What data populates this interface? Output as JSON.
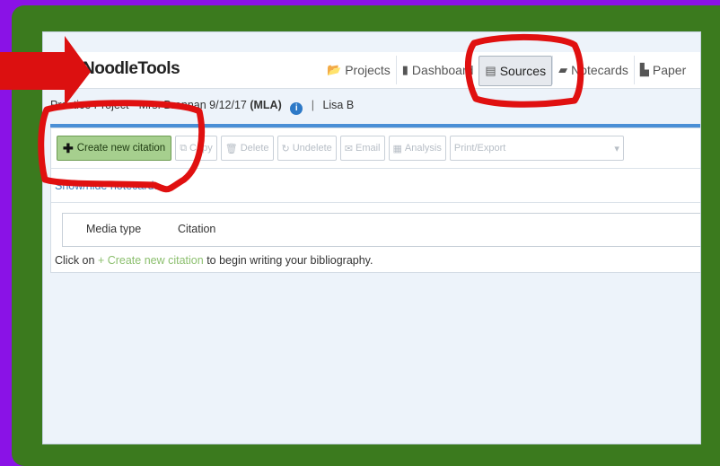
{
  "app": {
    "logo": "NoodleTools"
  },
  "nav": [
    {
      "label": "Projects",
      "icon": "folder-icon",
      "glyph": "📂",
      "active": false
    },
    {
      "label": "Dashboard",
      "icon": "bar-chart-icon",
      "glyph": "▮",
      "active": false
    },
    {
      "label": "Sources",
      "icon": "list-icon",
      "glyph": "▤",
      "active": true
    },
    {
      "label": "Notecards",
      "icon": "notecards-icon",
      "glyph": "▰",
      "active": false
    },
    {
      "label": "Paper",
      "icon": "document-icon",
      "glyph": "▙",
      "active": false
    }
  ],
  "project": {
    "title": "Practice Project - Mrs. Brennan 9/12/17",
    "style": "(MLA)",
    "info_glyph": "i",
    "separator": "|",
    "user": "Lisa B"
  },
  "toolbar": {
    "create_glyph": "✚",
    "create": "Create new citation",
    "copy_glyph": "⧉",
    "copy": "Copy",
    "delete_glyph": "🗑",
    "delete": "Delete",
    "undelete_glyph": "↻",
    "undelete": "Undelete",
    "email_glyph": "✉",
    "email": "Email",
    "analysis_glyph": "▦",
    "analysis": "Analysis",
    "print_export": "Print/Export",
    "caret": "▾"
  },
  "show_hide": "Show/hide notecards",
  "table": {
    "headers": [
      "Media type",
      "Citation"
    ]
  },
  "hint": {
    "before": "Click on ",
    "link": "+ Create new citation",
    "after": " to begin writing your bibliography."
  },
  "colors": {
    "frame": "#3b7a1e",
    "background": "#8a12e6",
    "annotation": "#e01010",
    "accent": "#4a8fd6",
    "create_button": "#a6cf8e"
  }
}
